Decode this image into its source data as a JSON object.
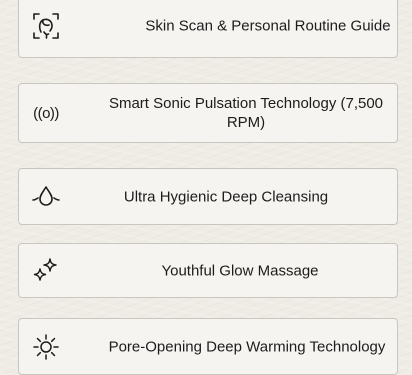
{
  "features": [
    {
      "icon": "face-scan-icon",
      "label": "Skin Scan & Personal Routine Guide"
    },
    {
      "icon": "sonic-pulse-icon",
      "icon_text": "((o))",
      "label": "Smart Sonic Pulsation Technology (7,500 RPM)"
    },
    {
      "icon": "water-drop-icon",
      "label": "Ultra Hygienic Deep Cleansing"
    },
    {
      "icon": "sparkle-icon",
      "label": "Youthful Glow Massage"
    },
    {
      "icon": "sun-icon",
      "label": "Pore-Opening Deep Warming Technology"
    }
  ],
  "colors": {
    "background": "#efece6",
    "card": "#f6f4f0",
    "border": "#c9c6c0",
    "text": "#1c1c1c"
  }
}
